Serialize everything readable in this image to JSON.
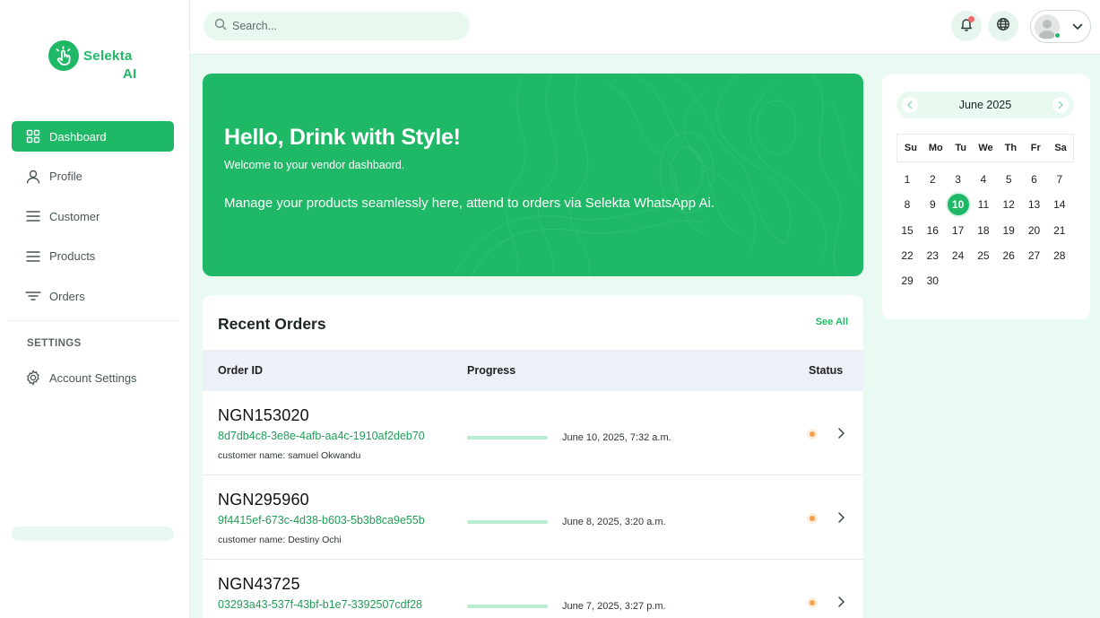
{
  "brand": {
    "name": "Selekta",
    "suffix": "AI",
    "color": "#1fb866"
  },
  "sidebar": {
    "items": [
      {
        "label": "Dashboard",
        "icon": "grid-icon",
        "active": true
      },
      {
        "label": "Profile",
        "icon": "user-icon",
        "active": false
      },
      {
        "label": "Customer",
        "icon": "list-icon",
        "active": false
      },
      {
        "label": "Products",
        "icon": "list-icon",
        "active": false
      },
      {
        "label": "Orders",
        "icon": "filter-icon",
        "active": false
      }
    ],
    "settings_label": "SETTINGS",
    "settings_items": [
      {
        "label": "Account Settings",
        "icon": "gear-icon"
      }
    ]
  },
  "topbar": {
    "search_placeholder": "Search...",
    "icons": [
      "bell-icon",
      "globe-icon",
      "avatar",
      "chevron-down-icon"
    ]
  },
  "hero": {
    "title": "Hello, Drink with Style!",
    "subtitle": "Welcome to your vendor dashbaord.",
    "message": "Manage your products seamlessly here, attend to orders via Selekta WhatsApp Ai."
  },
  "orders": {
    "title": "Recent Orders",
    "see_all": "See All",
    "columns": [
      "Order ID",
      "Progress",
      "Status"
    ],
    "rows": [
      {
        "order_id": "NGN153020",
        "uuid": "8d7db4c8-3e8e-4afb-aa4c-1910af2deb70",
        "customer": "customer name: samuel Okwandu",
        "date": "June 10, 2025, 7:32 a.m.",
        "status_color": "#f7a04a"
      },
      {
        "order_id": "NGN295960",
        "uuid": "9f4415ef-673c-4d38-b603-5b3b8ca9e55b",
        "customer": "customer name: Destiny Ochi",
        "date": "June 8, 2025, 3:20 a.m.",
        "status_color": "#f7a04a"
      },
      {
        "order_id": "NGN43725",
        "uuid": "03293a43-537f-43bf-b1e7-3392507cdf28",
        "customer": "",
        "date": "June 7, 2025, 3:27 p.m.",
        "status_color": "#f7a04a"
      }
    ]
  },
  "calendar": {
    "month_label": "June 2025",
    "weekdays": [
      "Su",
      "Mo",
      "Tu",
      "We",
      "Th",
      "Fr",
      "Sa"
    ],
    "first_weekday": 0,
    "days_in_month": 30,
    "today": 10
  }
}
